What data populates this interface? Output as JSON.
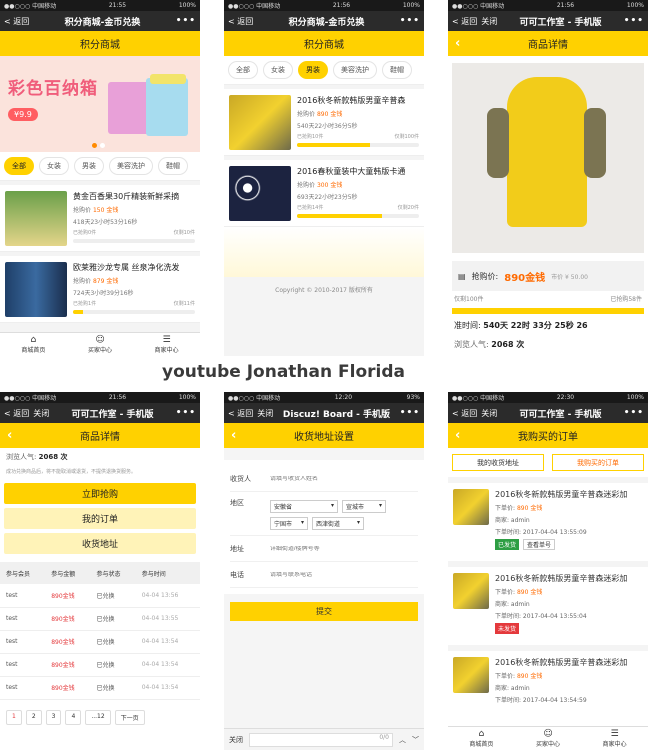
{
  "watermark": "youtube Jonathan Florida",
  "p1": {
    "status": {
      "carrier": "●●○○○ 中国移动",
      "time": "21:55",
      "battery": "100%"
    },
    "nav": {
      "back": "返回",
      "title": "积分商城-金币兑换"
    },
    "header": "积分商城",
    "banner": {
      "title": "彩色百纳箱",
      "price": "9.9"
    },
    "tabs": [
      "全部",
      "女装",
      "男装",
      "美容洗护",
      "鞋帽"
    ],
    "products": [
      {
        "name": "黄金百香果30斤精装新鲜采摘",
        "price_label": "抢购价",
        "price": "150",
        "unit": "金钱",
        "time": "418天23小时53分16秒",
        "sold": "已抢购0件",
        "left": "仅剩10件",
        "progress": 0.0
      },
      {
        "name": "欧莱雅沙龙专属 丝泉净化洗发",
        "price_label": "抢购价",
        "price": "879",
        "unit": "金钱",
        "time": "724天3小时39分16秒",
        "sold": "已抢购1件",
        "left": "仅剩11件",
        "progress": 0.08
      }
    ],
    "bottom": [
      "商城首页",
      "买家中心",
      "商家中心"
    ]
  },
  "p2": {
    "status": {
      "carrier": "●●○○○ 中国移动",
      "time": "21:56",
      "battery": "100%"
    },
    "nav": {
      "back": "返回",
      "title": "积分商城-金币兑换"
    },
    "header": "积分商城",
    "tabs": [
      "全部",
      "女装",
      "男装",
      "美容洗护",
      "鞋帽"
    ],
    "products": [
      {
        "name": "2016秋冬新款韩版男童辛普森",
        "price_label": "抢购价",
        "price": "890",
        "unit": "金钱",
        "time": "540天22小时36分5秒",
        "sold": "已抢购10件",
        "left": "仅剩100件",
        "progress": 0.6
      },
      {
        "name": "2016春秋童装中大童韩版卡通",
        "price_label": "抢购价",
        "price": "300",
        "unit": "金钱",
        "time": "693天22小时23分5秒",
        "sold": "已抢购14件",
        "left": "仅剩20件",
        "progress": 0.7
      }
    ],
    "copyright": "Copyright © 2010-2017 版权所有"
  },
  "p3": {
    "status": {
      "carrier": "●●○○○ 中国移动",
      "time": "21:56",
      "battery": "100%"
    },
    "nav": {
      "back": "返回",
      "close": "关闭",
      "title": "可可工作室 - 手机版"
    },
    "header": "商品详情",
    "price_label": "抢购价:",
    "price": "890金钱",
    "market": "市价 ¥ 50.00",
    "left": "仅剩100件",
    "sold": "已抢购58件",
    "countdown_label": "准时间:",
    "countdown": "540天 22时 33分 25秒 26",
    "popularity_label": "浏览人气:",
    "popularity": "2068 次"
  },
  "p4": {
    "status": {
      "carrier": "●●○○○ 中国移动",
      "time": "21:56",
      "battery": "100%"
    },
    "nav": {
      "back": "返回",
      "close": "关闭",
      "title": "可可工作室 - 手机版"
    },
    "header": "商品详情",
    "popularity_label": "浏览人气:",
    "popularity": "2068 次",
    "note": "成功兑换商品后，将不能取消或退货，不提供退换货服务。",
    "buttons": [
      "立即抢购",
      "我的订单",
      "收货地址"
    ],
    "table": {
      "headers": [
        "参与会员",
        "参与金额",
        "参与状态",
        "参与时间"
      ],
      "rows": [
        [
          "test",
          "890金钱",
          "已兑换",
          "04-04 13:56"
        ],
        [
          "test",
          "890金钱",
          "已兑换",
          "04-04 13:55"
        ],
        [
          "test",
          "890金钱",
          "已兑换",
          "04-04 13:54"
        ],
        [
          "test",
          "890金钱",
          "已兑换",
          "04-04 13:54"
        ],
        [
          "test",
          "890金钱",
          "已兑换",
          "04-04 13:54"
        ]
      ]
    },
    "pager": [
      "1",
      "2",
      "3",
      "4",
      "...12",
      "下一页"
    ]
  },
  "p5": {
    "status": {
      "carrier": "●●○○○ 中国移动",
      "time": "12:20",
      "battery": "93%"
    },
    "nav": {
      "back": "返回",
      "close": "关闭",
      "title": "Discuz! Board - 手机版"
    },
    "header": "收货地址设置",
    "fields": {
      "name_label": "收货人",
      "name_ph": "请填写收货人姓名",
      "region_label": "地区",
      "province": "安徽省",
      "city": "宣城市",
      "district": "宁国市",
      "street": "西津街道",
      "addr_label": "地址",
      "addr_ph": "详细街道/楼牌号等",
      "phone_label": "电话",
      "phone_ph": "请填写联系电话"
    },
    "submit": "提交",
    "composer": {
      "close": "关闭",
      "count": "0/0"
    }
  },
  "p6": {
    "status": {
      "carrier": "●●○○○ 中国移动",
      "time": "22:30",
      "battery": "100%"
    },
    "nav": {
      "back": "返回",
      "close": "关闭",
      "title": "可可工作室 - 手机版"
    },
    "header": "我购买的订单",
    "tabs": [
      "我的收货地址",
      "我购买的订单"
    ],
    "orders": [
      {
        "name": "2016秋冬新款韩版男童辛普森迷彩加",
        "price_label": "下单价",
        "price": "890",
        "unit": "金钱",
        "seller": "商家: admin",
        "time": "下单时间: 2017-04-04 13:55:09",
        "status": "已发货",
        "extra": "查看单号"
      },
      {
        "name": "2016秋冬新款韩版男童辛普森迷彩加",
        "price_label": "下单价",
        "price": "890",
        "unit": "金钱",
        "seller": "商家: admin",
        "time": "下单时间: 2017-04-04 13:55:04",
        "status": "未发货",
        "extra": ""
      },
      {
        "name": "2016秋冬新款韩版男童辛普森迷彩加",
        "price_label": "下单价",
        "price": "890",
        "unit": "金钱",
        "seller": "商家: admin",
        "time": "下单时间: 2017-04-04 13:54:59",
        "status": "",
        "extra": ""
      }
    ],
    "bottom": [
      "商城首页",
      "买家中心",
      "商家中心"
    ]
  }
}
